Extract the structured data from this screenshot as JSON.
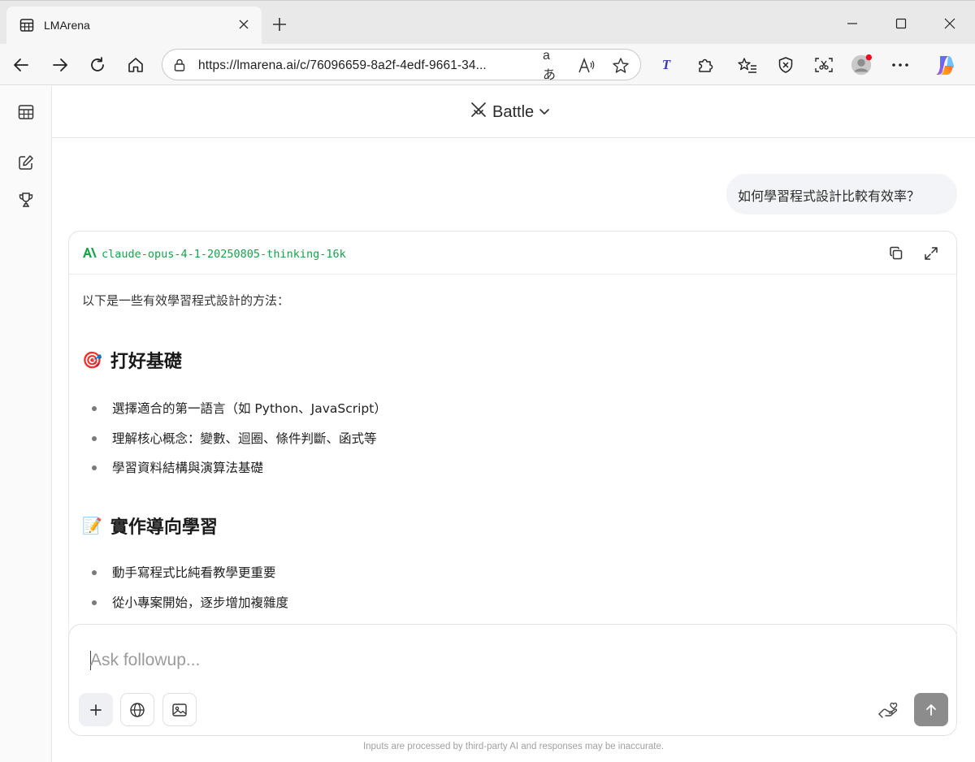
{
  "browser": {
    "tab_title": "LMArena",
    "url": "https://lmarena.ai/c/76096659-8a2f-4edf-9661-34...",
    "translate_icon_text": "aあ",
    "read_aloud_text": "A",
    "extension_t": "T"
  },
  "app": {
    "mode_label": "Battle",
    "user_message": "如何學習程式設計比較有效率？",
    "model_name": "claude-opus-4-1-20250805-thinking-16k",
    "response": {
      "intro": "以下是一些有效學習程式設計的方法：",
      "sections": [
        {
          "emoji": "🎯",
          "heading": "打好基礎",
          "bullets": [
            "選擇適合的第一語言（如 Python、JavaScript）",
            "理解核心概念：變數、迴圈、條件判斷、函式等",
            "學習資料結構與演算法基礎"
          ]
        },
        {
          "emoji": "📝",
          "heading": "實作導向學習",
          "bullets": [
            "動手寫程式比純看教學更重要",
            "從小專案開始，逐步增加複雜度"
          ]
        }
      ]
    },
    "composer": {
      "placeholder": "Ask followup..."
    },
    "disclaimer": "Inputs are processed by third-party AI and responses may be inaccurate."
  }
}
